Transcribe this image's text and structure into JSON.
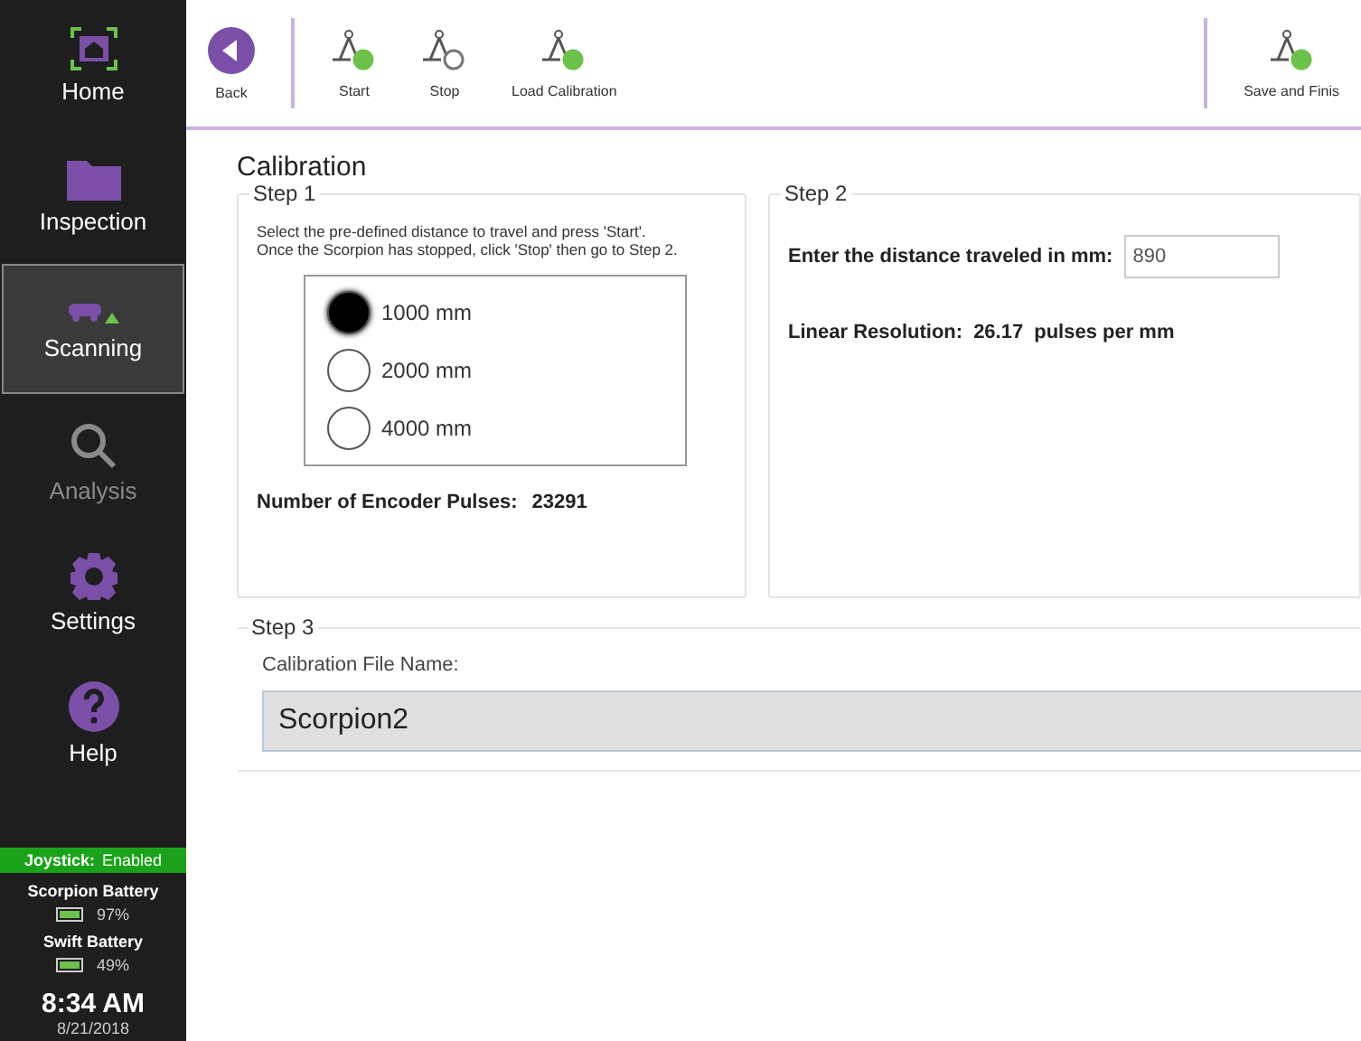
{
  "sidebar": {
    "items": [
      {
        "kind": "home",
        "label": "Home",
        "selected": false,
        "disabled": false
      },
      {
        "kind": "folder",
        "label": "Inspection",
        "selected": false,
        "disabled": false
      },
      {
        "kind": "scanner",
        "label": "Scanning",
        "selected": true,
        "disabled": false
      },
      {
        "kind": "search",
        "label": "Analysis",
        "selected": false,
        "disabled": true
      },
      {
        "kind": "gear",
        "label": "Settings",
        "selected": false,
        "disabled": false
      },
      {
        "kind": "help",
        "label": "Help",
        "selected": false,
        "disabled": false
      }
    ],
    "joystick": {
      "label": "Joystick:",
      "value": "Enabled"
    },
    "batteries": [
      {
        "name": "Scorpion Battery",
        "percent": "97%"
      },
      {
        "name": "Swift Battery",
        "percent": "49%"
      }
    ],
    "time": "8:34 AM",
    "date": "8/21/2018"
  },
  "toolbar": {
    "left": [
      {
        "kind": "back",
        "label": "Back"
      },
      {
        "kind": "start",
        "label": "Start"
      },
      {
        "kind": "stop",
        "label": "Stop"
      },
      {
        "kind": "load",
        "label": "Load Calibration"
      }
    ],
    "right": [
      {
        "kind": "save",
        "label": "Save and Finis"
      }
    ]
  },
  "page_title": "Calibration",
  "step1": {
    "title": "Step 1",
    "instructions": "Select the pre-defined distance to travel and press 'Start'.\nOnce the Scorpion has stopped, click 'Stop' then go to Step 2.",
    "options": [
      {
        "label": "1000 mm",
        "selected": true
      },
      {
        "label": "2000 mm",
        "selected": false
      },
      {
        "label": "4000 mm",
        "selected": false
      }
    ],
    "pulses_label": "Number of Encoder Pulses:",
    "pulses_value": "23291"
  },
  "step2": {
    "title": "Step 2",
    "distance_label": "Enter the distance traveled in mm:",
    "distance_value": "890",
    "resolution_label": "Linear Resolution:",
    "resolution_value": "26.17",
    "resolution_unit": "pulses per mm"
  },
  "step3": {
    "title": "Step 3",
    "file_label": "Calibration File Name:",
    "file_value": "Scorpion2"
  }
}
